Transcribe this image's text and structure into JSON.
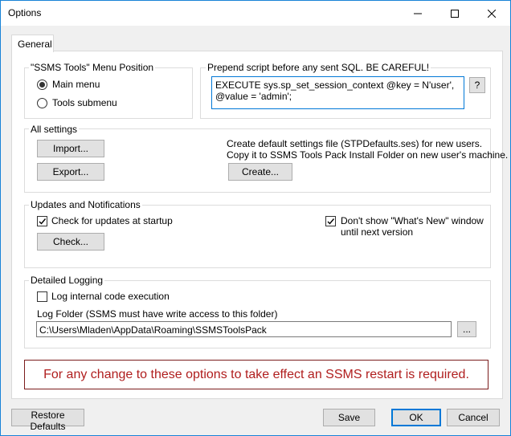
{
  "window": {
    "title": "Options"
  },
  "tabs": [
    {
      "label": "General"
    }
  ],
  "menu_position": {
    "title": "\"SSMS Tools\" Menu Position",
    "options": [
      {
        "label": "Main menu",
        "selected": true
      },
      {
        "label": "Tools submenu",
        "selected": false
      }
    ]
  },
  "prepend": {
    "title": "Prepend script before any sent SQL. BE CAREFUL!",
    "value": "EXECUTE sys.sp_set_session_context @key = N'user', @value = 'admin';",
    "help_label": "?"
  },
  "all_settings": {
    "title": "All settings",
    "import_label": "Import...",
    "export_label": "Export...",
    "create_line1": "Create default settings file (STPDefaults.ses) for new users.",
    "create_line2": "Copy it to SSMS Tools Pack Install Folder on new user's machine.",
    "create_label": "Create..."
  },
  "updates": {
    "title": "Updates and Notifications",
    "check_startup": {
      "label": "Check for updates at startup",
      "checked": true
    },
    "check_label": "Check...",
    "whats_new_line1": "Don't show \"What's New\" window",
    "whats_new_line2": "until next version",
    "whats_new_checked": true
  },
  "logging": {
    "title": "Detailed Logging",
    "log_internal": {
      "label": "Log internal code execution",
      "checked": false
    },
    "folder_label": "Log Folder (SSMS must have write access to this folder)",
    "folder_value": "C:\\Users\\Mladen\\AppData\\Roaming\\SSMSToolsPack",
    "browse_label": "..."
  },
  "warning": "For any change to these options to take effect an SSMS restart is required.",
  "footer": {
    "restore_label": "Restore Defaults",
    "save_label": "Save",
    "ok_label": "OK",
    "cancel_label": "Cancel"
  },
  "colors": {
    "accent": "#0078d7",
    "warning_text": "#b01e1e",
    "warning_border": "#7b1c1c"
  }
}
